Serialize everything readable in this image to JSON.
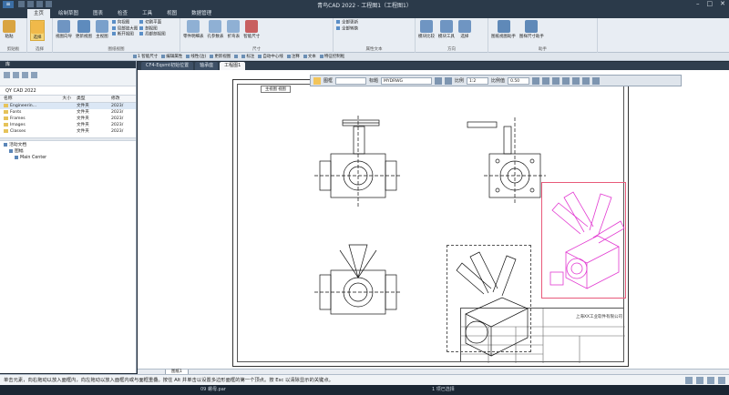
{
  "window": {
    "title": "青鸟CAD 2022 - 工程图1（工程图1）",
    "app_button": "≡"
  },
  "tabs": [
    "主页",
    "绘制草图",
    "图表",
    "检查",
    "工具",
    "视图",
    "数据管理"
  ],
  "active_tab": "主页",
  "ribbon": {
    "groups": [
      {
        "name": "剪贴板",
        "buttons": [
          "粘贴"
        ],
        "small": []
      },
      {
        "name": "选择",
        "buttons": [
          "选择"
        ],
        "small": []
      },
      {
        "name": "图纸视图",
        "buttons": [
          "视图向导",
          "更新视图",
          "主视图"
        ],
        "small": [
          "向视图",
          "局部放大图",
          "断开视图",
          "切割平面",
          "剖视图",
          "局部剖视图"
        ]
      },
      {
        "name": "尺寸",
        "buttons": [
          "零件明细表",
          "孔参数表",
          "折弯表",
          "智能尺寸"
        ],
        "small": []
      },
      {
        "name": "属性文本",
        "buttons": [],
        "small": [
          "全部更新",
          "全部转换"
        ]
      },
      {
        "name": "方向",
        "buttons": [
          "模块比较",
          "模块工具",
          "选择"
        ],
        "small": []
      },
      {
        "name": "助手",
        "buttons": [
          "图纸视图助手",
          "图样尺寸助手"
        ],
        "small": []
      }
    ]
  },
  "cmdbar": [
    "1 智能尺寸",
    "编辑属性",
    "线性(边)",
    "更新视图",
    "",
    "标注",
    "自动中心线",
    "注释",
    "文本",
    "特征控制框"
  ],
  "left_panel": {
    "title": "库",
    "path": "QY CAD 2022",
    "columns": [
      "名称",
      "大小",
      "类型",
      "修改"
    ],
    "rows": [
      {
        "name": "Engineerin…",
        "size": "",
        "type": "文件夹",
        "date": "2023/"
      },
      {
        "name": "Fonts",
        "size": "",
        "type": "文件夹",
        "date": "2023/"
      },
      {
        "name": "Frames",
        "size": "",
        "type": "文件夹",
        "date": "2023/"
      },
      {
        "name": "Images",
        "size": "",
        "type": "文件夹",
        "date": "2023/"
      },
      {
        "name": "Classes",
        "size": "",
        "type": "文件夹",
        "date": "2023/"
      }
    ],
    "tree": [
      {
        "label": "活动文档",
        "level": 0
      },
      {
        "label": "图幅",
        "level": 1
      },
      {
        "label": "Main Center",
        "level": 2
      }
    ]
  },
  "doc_tabs": [
    {
      "label": "CF4-Eqsmt初始位置",
      "active": false
    },
    {
      "label": "轴承座",
      "active": false
    },
    {
      "label": "工程图1",
      "active": true
    }
  ],
  "viewbar": {
    "layer_label": "图框",
    "title_label": "标题",
    "title_value": "MYDRWG",
    "scale_label": "比例",
    "scale_value": "1:2",
    "scale2_label": "比例值",
    "scale2_value": "0.50"
  },
  "drawing": {
    "main_view_label": "主视图 视图",
    "company": "上海XX工业软件有限公司"
  },
  "sheet_tabs": [
    "图纸1"
  ],
  "statusbar": {
    "text": "单击元素，向右拖动以放入面框内，向左拖动以放入面框内或与面框重叠。按住 Alt 并单击以设置多边形面框的第一个顶点。按 Esc 以清除显示的关键点。"
  },
  "taskbar": [
    "09 螺母.par",
    "1 项已选择"
  ]
}
